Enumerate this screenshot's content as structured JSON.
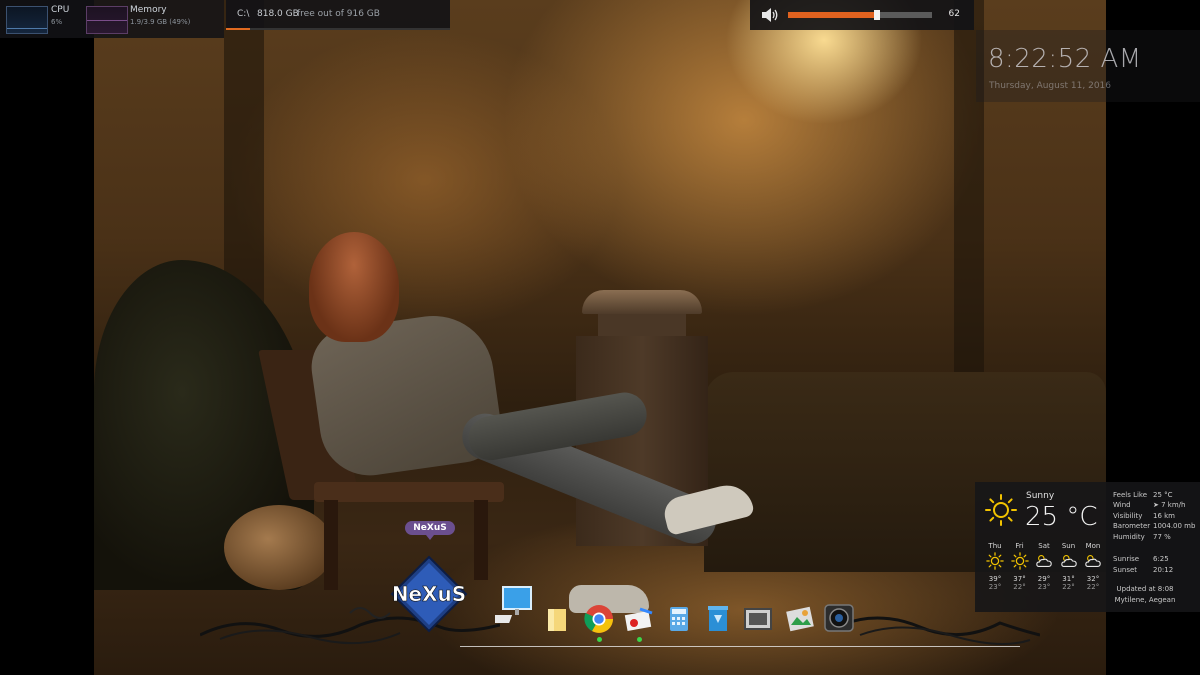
{
  "system": {
    "cpu": {
      "label": "CPU",
      "value": "6%"
    },
    "memory": {
      "label": "Memory",
      "value": "1.9/3.9 GB (49%)"
    }
  },
  "disk": {
    "drive": "C:\\",
    "size": "818.0 GB",
    "status": "free out of 916 GB",
    "used_fraction": 0.107
  },
  "volume": {
    "icon": "speaker-icon",
    "level": 62,
    "value_label": "62",
    "accent": "#e0621f"
  },
  "clock": {
    "time": "8:22:52 AM",
    "date": "Thursday, August 11, 2016"
  },
  "weather": {
    "condition": "Sunny",
    "temperature": "25 °C",
    "details": [
      {
        "label": "Feels Like",
        "value": "25 °C"
      },
      {
        "label": "Wind",
        "value": "➤ 7 km/h"
      },
      {
        "label": "Visibility",
        "value": "16 km"
      },
      {
        "label": "Barometer",
        "value": "1004.00 mb"
      },
      {
        "label": "Humidity",
        "value": "77 %"
      }
    ],
    "sun": [
      {
        "label": "Sunrise",
        "value": "6:25"
      },
      {
        "label": "Sunset",
        "value": "20:12"
      }
    ],
    "forecast": [
      {
        "day": "Thu",
        "icon": "sun-icon",
        "high": "39°",
        "low": "23°"
      },
      {
        "day": "Fri",
        "icon": "sun-icon",
        "high": "37°",
        "low": "22°"
      },
      {
        "day": "Sat",
        "icon": "partly-cloudy-icon",
        "high": "29°",
        "low": "23°"
      },
      {
        "day": "Sun",
        "icon": "partly-cloudy-icon",
        "high": "31°",
        "low": "22°"
      },
      {
        "day": "Mon",
        "icon": "partly-cloudy-icon",
        "high": "32°",
        "low": "22°"
      }
    ],
    "updated": "Updated at 8:08",
    "location": "Mytilene, Aegean"
  },
  "dock": {
    "tag": "NeXuS",
    "logo_text": "NeXuS",
    "items": [
      {
        "name": "computer-icon",
        "running": false
      },
      {
        "name": "folder-icon",
        "running": false
      },
      {
        "name": "chrome-icon",
        "running": true
      },
      {
        "name": "mail-icon",
        "running": true
      },
      {
        "name": "calculator-icon",
        "running": false
      },
      {
        "name": "recycle-bin-icon",
        "running": false
      },
      {
        "name": "media-player-icon",
        "running": false
      },
      {
        "name": "photos-icon",
        "running": false
      },
      {
        "name": "camera-icon",
        "running": false
      }
    ]
  }
}
